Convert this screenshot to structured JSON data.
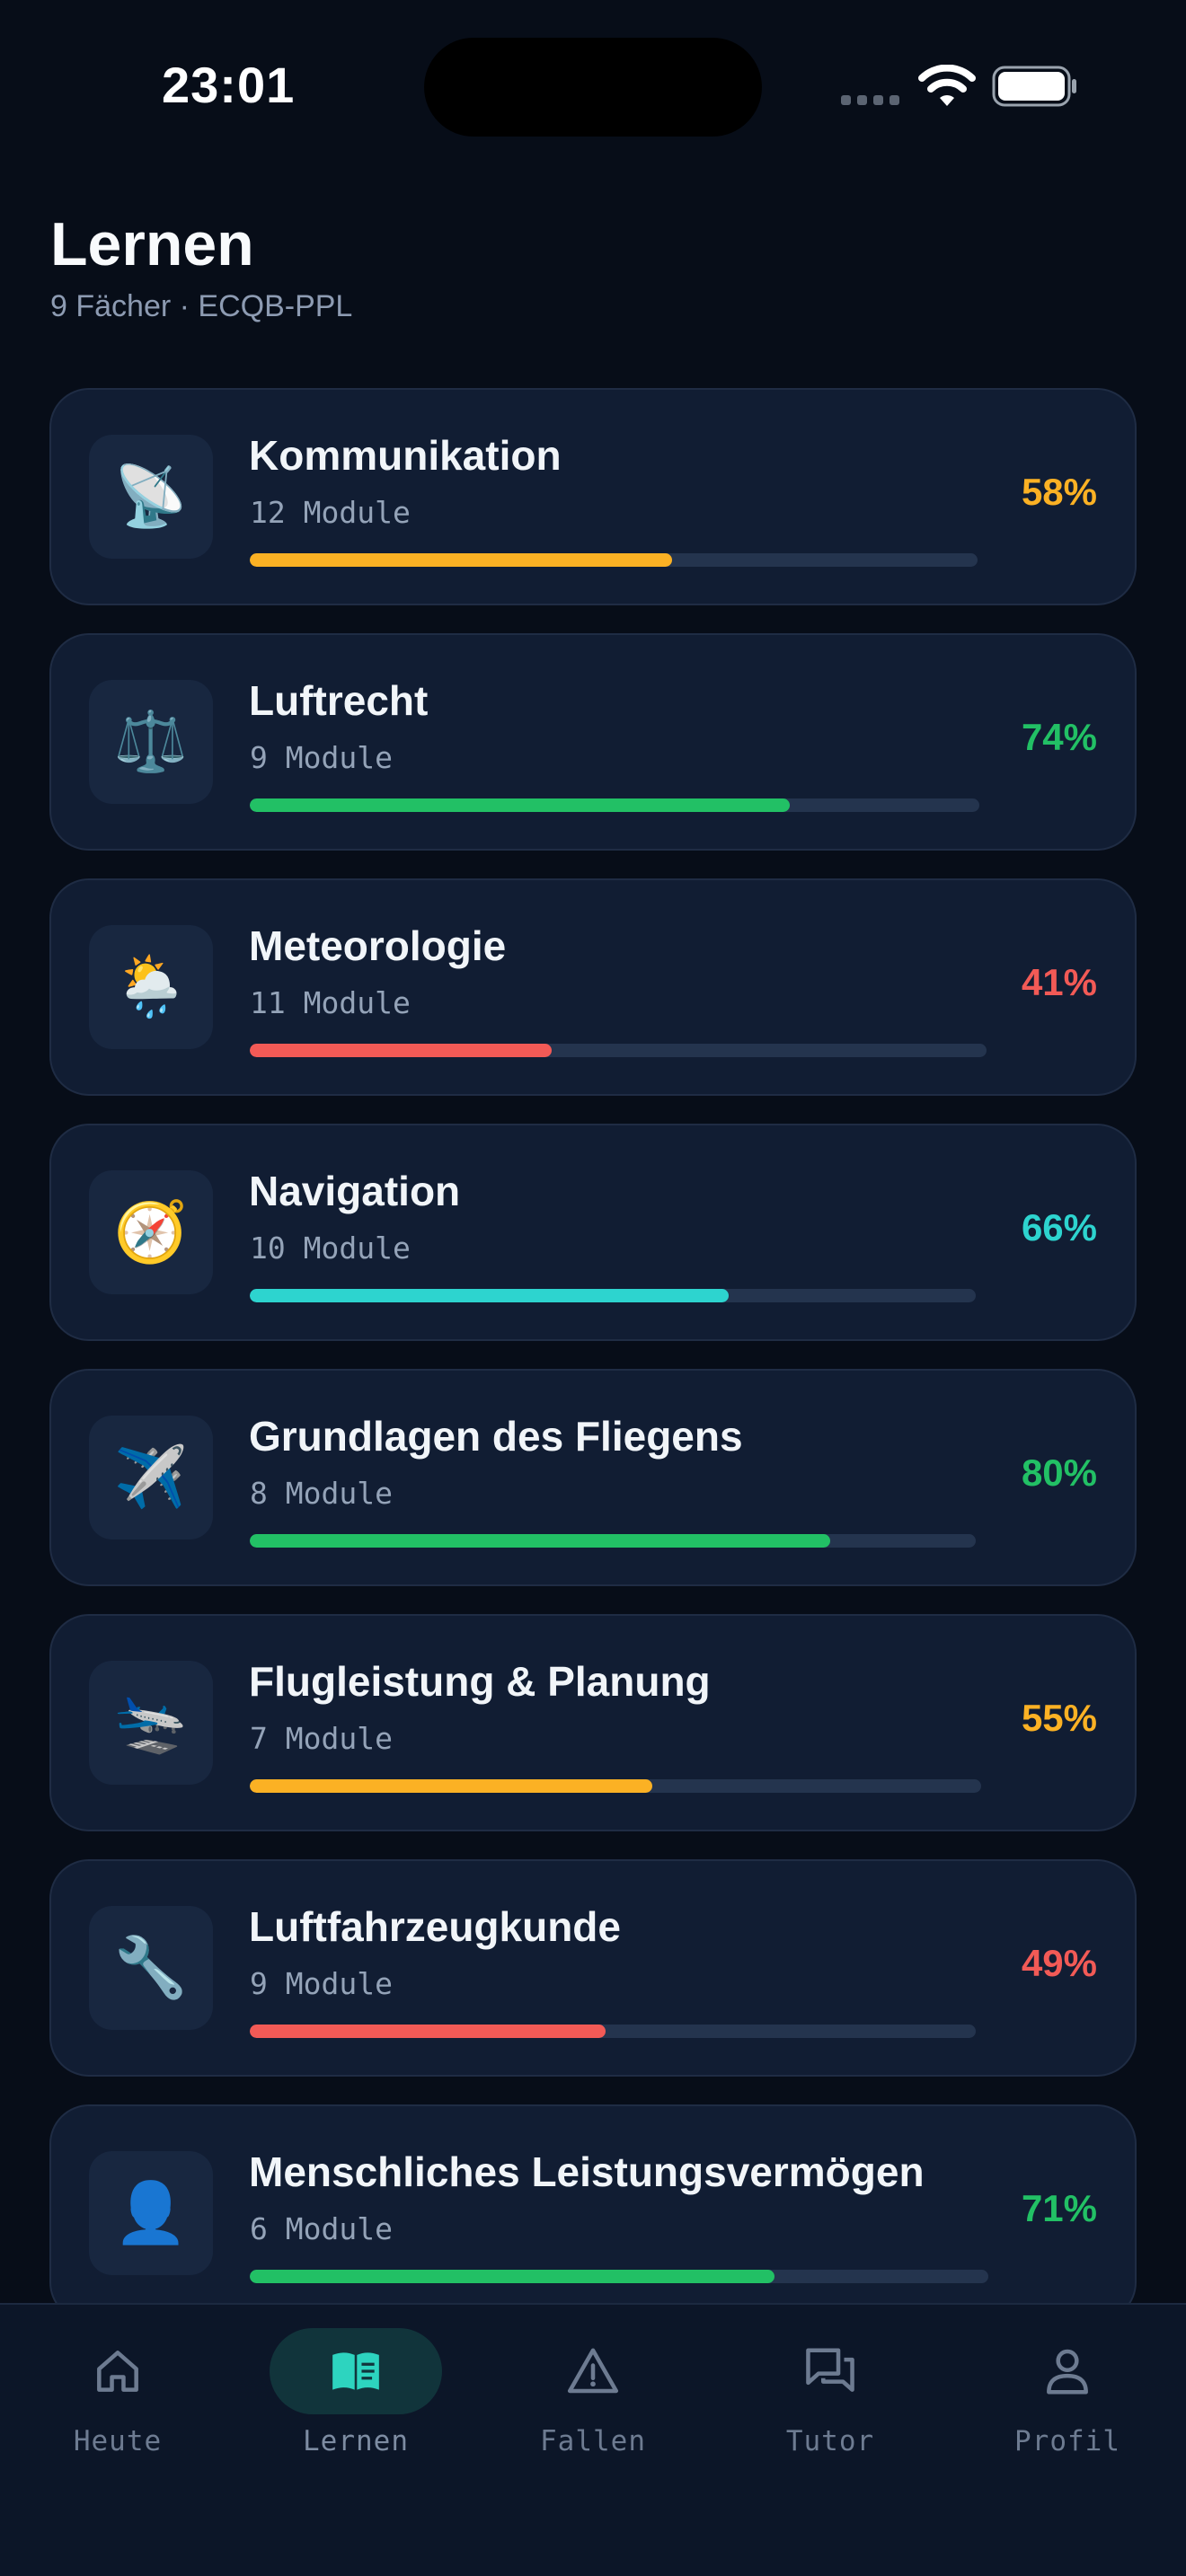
{
  "status_bar": {
    "time": "23:01"
  },
  "header": {
    "title": "Lernen",
    "subtitle": "9 Fächer · ECQB-PPL"
  },
  "subjects": [
    {
      "name": "Kommunikation",
      "modules": "12 Module",
      "progress": 0.58,
      "percent": "58%",
      "color": "#fbb124",
      "emoji": "📡",
      "icon": "satellite-dish-icon"
    },
    {
      "name": "Luftrecht",
      "modules": "9 Module",
      "progress": 0.74,
      "percent": "74%",
      "color": "#22c065",
      "emoji": "⚖️",
      "icon": "scales-icon"
    },
    {
      "name": "Meteorologie",
      "modules": "11 Module",
      "progress": 0.41,
      "percent": "41%",
      "color": "#f25a56",
      "emoji": "🌦️",
      "icon": "weather-icon"
    },
    {
      "name": "Navigation",
      "modules": "10 Module",
      "progress": 0.66,
      "percent": "66%",
      "color": "#2dd4cf",
      "emoji": "🧭",
      "icon": "compass-icon"
    },
    {
      "name": "Grundlagen des Fliegens",
      "modules": "8 Module",
      "progress": 0.8,
      "percent": "80%",
      "color": "#22c065",
      "emoji": "✈️",
      "icon": "airplane-icon"
    },
    {
      "name": "Flugleistung & Planung",
      "modules": "7 Module",
      "progress": 0.55,
      "percent": "55%",
      "color": "#fbb124",
      "emoji": "🛬",
      "icon": "airplane-landing-icon"
    },
    {
      "name": "Luftfahrzeugkunde",
      "modules": "9 Module",
      "progress": 0.49,
      "percent": "49%",
      "color": "#f25a56",
      "emoji": "🔧",
      "icon": "wrench-icon"
    },
    {
      "name": "Menschliches Leistungsvermögen",
      "modules": "6 Module",
      "progress": 0.71,
      "percent": "71%",
      "color": "#22c065",
      "emoji": "👤",
      "icon": "person-icon"
    }
  ],
  "tabs": [
    {
      "label": "Heute",
      "icon": "home-icon",
      "active": false
    },
    {
      "label": "Lernen",
      "icon": "book-icon",
      "active": true
    },
    {
      "label": "Fallen",
      "icon": "warning-icon",
      "active": false
    },
    {
      "label": "Tutor",
      "icon": "chat-icon",
      "active": false
    },
    {
      "label": "Profil",
      "icon": "user-icon",
      "active": false
    }
  ],
  "colors": {
    "accent": "#2dd4bf",
    "background": "#070d18",
    "card": "#111d33"
  }
}
